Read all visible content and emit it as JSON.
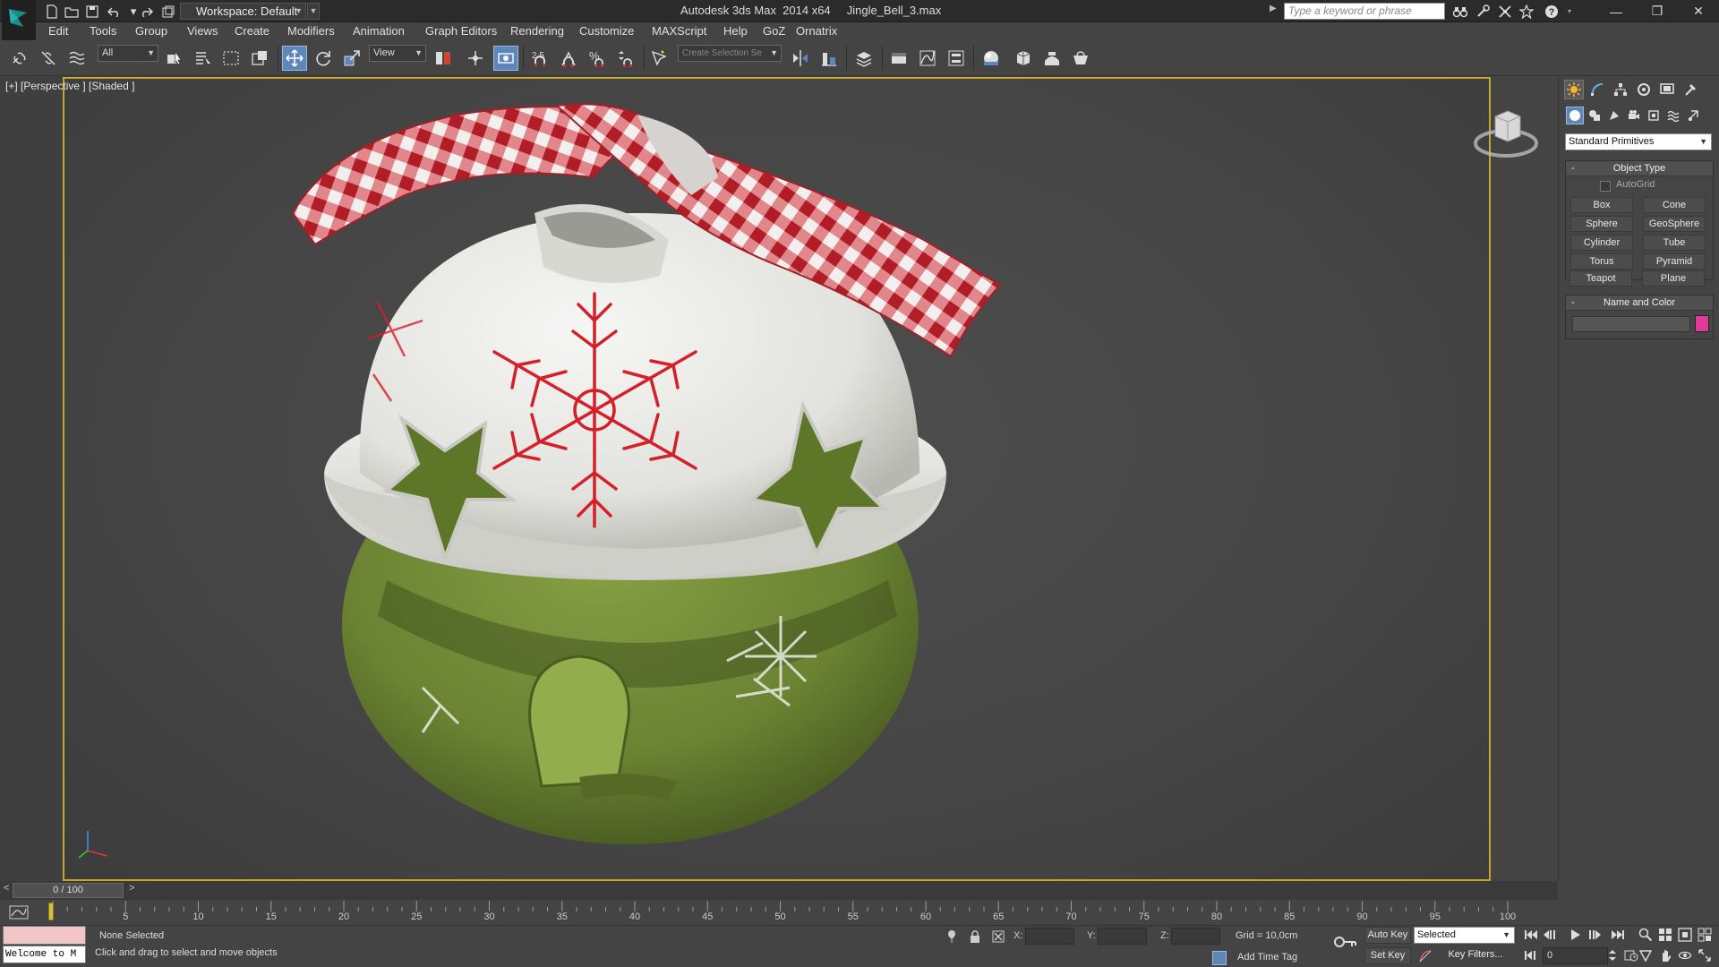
{
  "window": {
    "title": "Autodesk 3ds Max  2014 x64     Jingle_Bell_3.max",
    "workspace_label": "Workspace: Default",
    "search_placeholder": "Type a keyword or phrase",
    "minimize_glyph": "—",
    "maximize_glyph": "❐",
    "close_glyph": "✕"
  },
  "menu": {
    "items": [
      "Edit",
      "Tools",
      "Group",
      "Views",
      "Create",
      "Modifiers",
      "Animation",
      "Graph Editors",
      "Rendering",
      "Customize",
      "MAXScript",
      "Help",
      "GoZ",
      "Ornatrix"
    ]
  },
  "toolbar": {
    "selection_filter": "All",
    "reference_coord": "View",
    "angle_snap_label": "2.5",
    "named_selection_placeholder": "Create Selection Se"
  },
  "viewport": {
    "label": "[+] [Perspective ] [Shaded ]"
  },
  "command_panel": {
    "category": "Standard Primitives",
    "object_type_title": "Object Type",
    "autogrid_label": "AutoGrid",
    "buttons": [
      "Box",
      "Cone",
      "Sphere",
      "GeoSphere",
      "Cylinder",
      "Tube",
      "Torus",
      "Pyramid",
      "Teapot",
      "Plane"
    ],
    "name_color_title": "Name and Color",
    "swatch_color": "#e0389b",
    "rollout_minus": "-"
  },
  "time_slider": {
    "position": "0 / 100",
    "left_arrow": "<",
    "right_arrow": ">"
  },
  "track_bar": {
    "ticks": [
      "5",
      "10",
      "15",
      "20",
      "25",
      "30",
      "35",
      "40",
      "45",
      "50",
      "55",
      "60",
      "65",
      "70",
      "75",
      "80",
      "85",
      "90",
      "95",
      "100"
    ]
  },
  "status": {
    "maxscript_text": "Welcome to M",
    "selection": "None Selected",
    "prompt": "Click and drag to select and move objects",
    "x_label": "X:",
    "y_label": "Y:",
    "z_label": "Z:",
    "grid": "Grid = 10,0cm",
    "add_time_tag": "Add Time Tag",
    "auto_key": "Auto Key",
    "set_key": "Set Key",
    "key_mode": "Selected",
    "key_filters": "Key Filters...",
    "current_frame": "0"
  },
  "colors": {
    "viewport_border": "#c8a431",
    "active_tool": "#5f86b8",
    "ribbon_red": "#c0242c",
    "bell_white": "#ececea",
    "bell_green": "#6d8534",
    "snowflake_red": "#d3202a"
  }
}
